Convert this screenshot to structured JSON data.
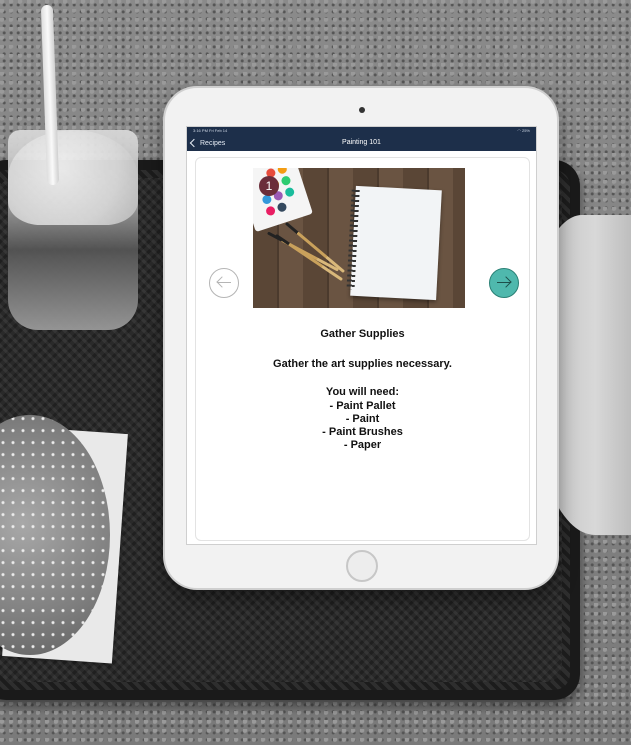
{
  "status_bar": {
    "time_date": "3:16 PM  Fri Feb 14",
    "battery": "25%"
  },
  "nav": {
    "back_label": "Recipes",
    "title": "Painting 101"
  },
  "step": {
    "badge": "1",
    "title": "Gather Supplies",
    "description": "Gather the art supplies necessary.",
    "needs_heading": "You will need:",
    "supplies": [
      "- Paint Pallet",
      "- Paint",
      "- Paint Brushes",
      "- Paper"
    ]
  },
  "icons": {
    "back": "chevron-left-icon",
    "prev": "arrow-left-icon",
    "next": "arrow-right-icon"
  },
  "colors": {
    "nav_bar": "#1d2f4a",
    "next_button": "#4fb8ad",
    "step_badge": "#6b2d3a"
  }
}
